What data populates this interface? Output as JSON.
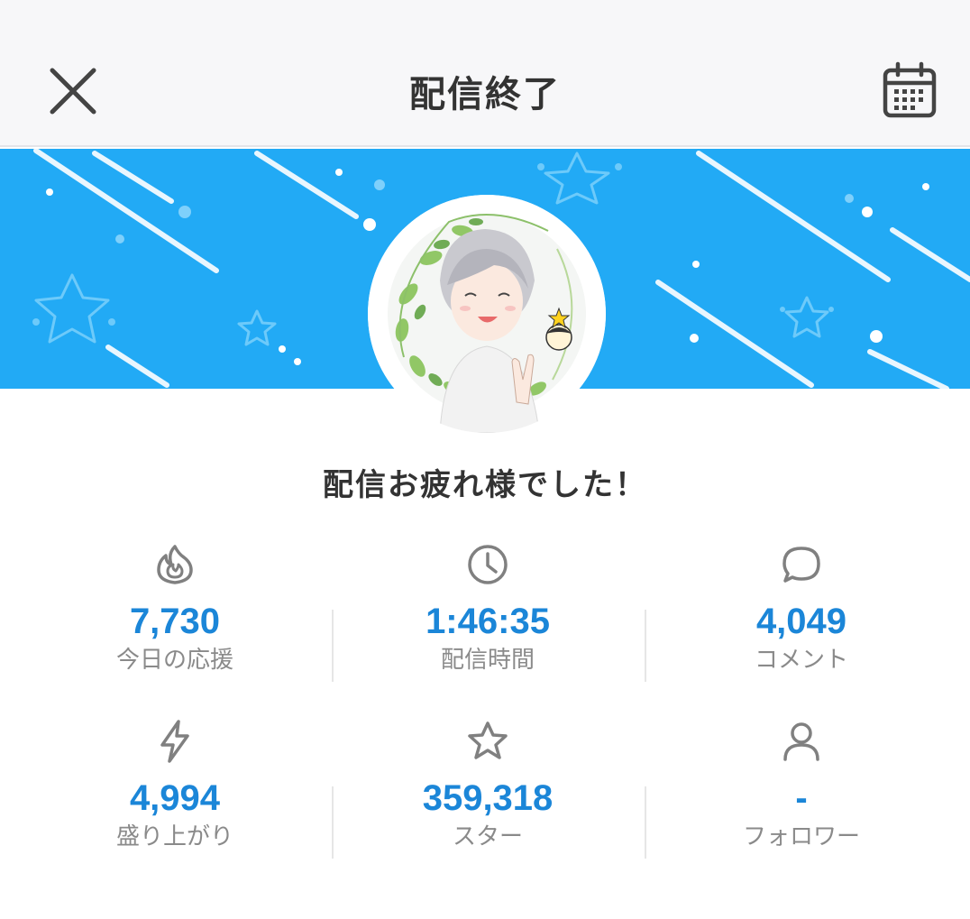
{
  "header": {
    "title": "配信終了",
    "close_icon": "close-icon",
    "calendar_icon": "calendar-icon"
  },
  "banner": {
    "background_color": "#22aaf5"
  },
  "avatar": {
    "description_icon": "avatar"
  },
  "message": "配信お疲れ様でした！",
  "stats": [
    {
      "icon": "flame-icon",
      "value": "7,730",
      "label": "今日の応援"
    },
    {
      "icon": "clock-icon",
      "value": "1:46:35",
      "label": "配信時間"
    },
    {
      "icon": "comment-icon",
      "value": "4,049",
      "label": "コメント"
    },
    {
      "icon": "lightning-icon",
      "value": "4,994",
      "label": "盛り上がり"
    },
    {
      "icon": "star-icon",
      "value": "359,318",
      "label": "スター"
    },
    {
      "icon": "person-icon",
      "value": "-",
      "label": "フォロワー"
    }
  ],
  "colors": {
    "accent": "#1b86d8",
    "label": "#8a8a8a",
    "title": "#333333"
  }
}
